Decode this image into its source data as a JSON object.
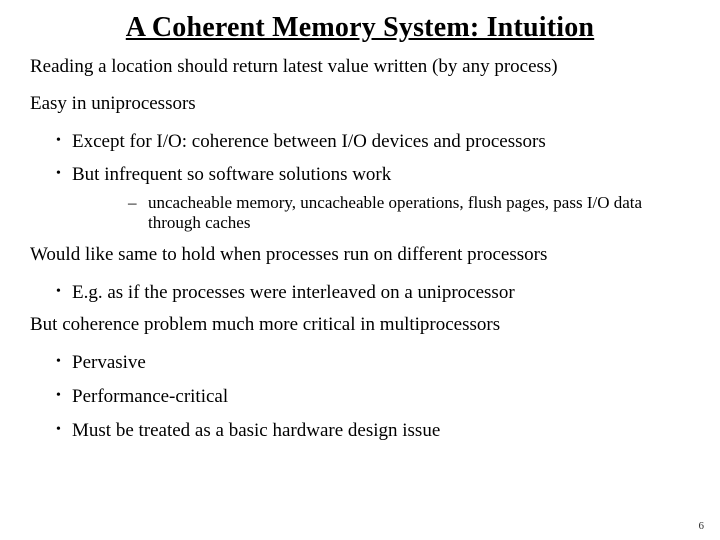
{
  "title": "A Coherent Memory System:  Intuition",
  "p1": "Reading a location should return latest value written (by any process)",
  "p2": "Easy in uniprocessors",
  "l1": {
    "b1": "Except for I/O: coherence between I/O devices and processors",
    "b2": "But infrequent so software solutions work",
    "s1": "uncacheable memory, uncacheable operations, flush pages, pass I/O data through caches"
  },
  "p3": "Would like same to hold when processes run on different processors",
  "l2": {
    "b1": "E.g. as if the processes were interleaved on a uniprocessor"
  },
  "p4": "But coherence problem much more critical in multiprocessors",
  "l3": {
    "b1": "Pervasive",
    "b2": "Performance-critical",
    "b3": "Must be treated as a basic hardware design issue"
  },
  "page": "6"
}
